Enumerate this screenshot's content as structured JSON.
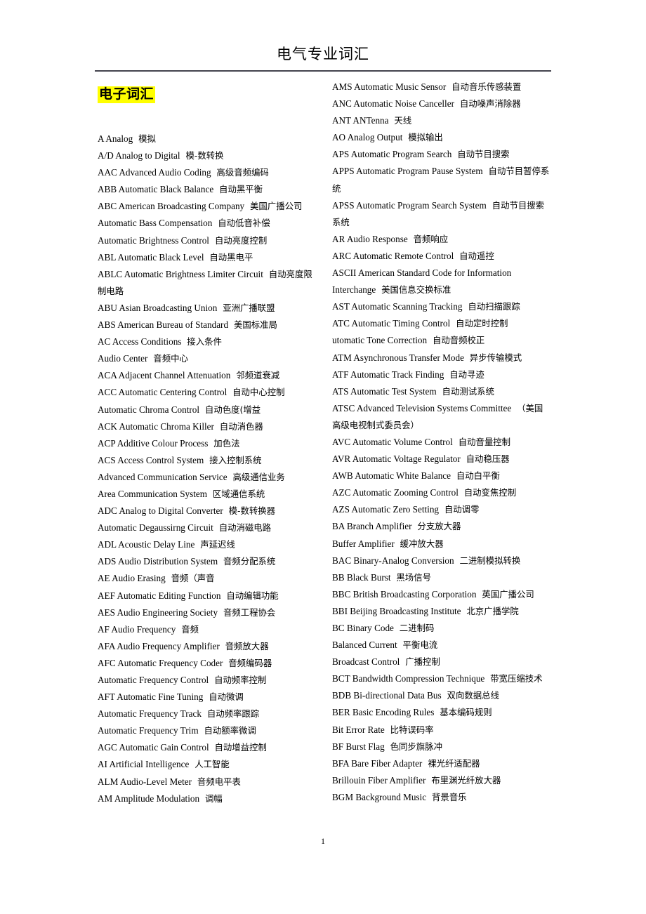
{
  "document": {
    "title": "电气专业词汇",
    "page_number": "1",
    "section_heading": "电子词汇",
    "highlight_color": "#ffff00",
    "rule_color": "#43434d"
  },
  "columns": {
    "left": [
      {
        "term": "A Analog",
        "cn": "模拟"
      },
      {
        "term": "A/D Analog to Digital",
        "cn": "模-数转换"
      },
      {
        "term": "AAC Advanced Audio Coding",
        "cn": "高级音频编码"
      },
      {
        "term": "ABB Automatic Black Balance",
        "cn": "自动黑平衡"
      },
      {
        "term": "ABC American Broadcasting Company",
        "cn": "美国广播公司"
      },
      {
        "term": "Automatic Bass Compensation",
        "cn": "自动低音补偿"
      },
      {
        "term": "Automatic Brightness Control",
        "cn": "自动亮度控制"
      },
      {
        "term": "ABL Automatic Black Level",
        "cn": "自动黑电平"
      },
      {
        "term": "ABLC Automatic Brightness Limiter Circuit",
        "cn": "自动亮度限制电路"
      },
      {
        "term": "ABU Asian Broadcasting Union",
        "cn": "亚洲广播联盟"
      },
      {
        "term": "ABS American Bureau of Standard",
        "cn": "美国标准局"
      },
      {
        "term": "AC Access Conditions",
        "cn": "接入条件"
      },
      {
        "term": "Audio Center",
        "cn": "音频中心"
      },
      {
        "term": "ACA Adjacent Channel Attenuation",
        "cn": "邻频道衰减"
      },
      {
        "term": "ACC Automatic Centering Control",
        "cn": "自动中心控制"
      },
      {
        "term": "Automatic Chroma Control",
        "cn": "自动色度(增益"
      },
      {
        "term": "ACK Automatic Chroma Killer",
        "cn": "自动消色器"
      },
      {
        "term": "ACP Additive Colour Process",
        "cn": "加色法"
      },
      {
        "term": "ACS Access Control System",
        "cn": "接入控制系统"
      },
      {
        "term": "Advanced Communication Service",
        "cn": "高级通信业务"
      },
      {
        "term": "Area Communication System",
        "cn": "区域通信系统"
      },
      {
        "term": "ADC Analog to Digital Converter",
        "cn": "模-数转换器"
      },
      {
        "term": "Automatic Degaussirng Circuit",
        "cn": "自动消磁电路"
      },
      {
        "term": "ADL Acoustic Delay Line",
        "cn": "声延迟线"
      },
      {
        "term": "ADS Audio Distribution System",
        "cn": "音频分配系统"
      },
      {
        "term": "AE Audio Erasing",
        "cn": "音频（声音"
      },
      {
        "term": "AEF Automatic Editing Function",
        "cn": "自动编辑功能"
      },
      {
        "term": "AES Audio Engineering Society",
        "cn": "音频工程协会"
      },
      {
        "term": "AF Audio Frequency",
        "cn": "音频"
      },
      {
        "term": "AFA Audio Frequency Amplifier",
        "cn": "音频放大器"
      },
      {
        "term": "AFC Automatic Frequency Coder",
        "cn": "音频编码器"
      },
      {
        "term": "Automatic Frequency Control",
        "cn": "自动频率控制"
      },
      {
        "term": "AFT Automatic Fine Tuning",
        "cn": "自动微调"
      },
      {
        "term": "Automatic Frequency Track",
        "cn": "自动频率跟踪"
      },
      {
        "term": "Automatic Frequency Trim",
        "cn": "自动额率微调"
      },
      {
        "term": "AGC Automatic Gain Control",
        "cn": "自动增益控制"
      },
      {
        "term": "AI Artificial Intelligence",
        "cn": "人工智能"
      },
      {
        "term": "ALM Audio-Level Meter",
        "cn": "音频电平表"
      },
      {
        "term": "AM Amplitude Modulation",
        "cn": "调幅"
      }
    ],
    "right": [
      {
        "term": "AMS Automatic Music Sensor",
        "cn": "自动音乐传感装置"
      },
      {
        "term": "ANC Automatic Noise Canceller",
        "cn": "自动噪声消除器"
      },
      {
        "term": "ANT ANTenna",
        "cn": "天线"
      },
      {
        "term": "AO Analog Output",
        "cn": "模拟输出"
      },
      {
        "term": "APS Automatic Program Search",
        "cn": "自动节目搜索"
      },
      {
        "term": "APPS Automatic Program Pause System",
        "cn": "自动节目暂停系统"
      },
      {
        "term": "APSS Automatic Program Search System",
        "cn": "自动节目搜索系统"
      },
      {
        "term": "AR Audio Response",
        "cn": "音频响应"
      },
      {
        "term": "ARC Automatic Remote Control",
        "cn": "自动遥控"
      },
      {
        "term": "ASCII American Standard Code for Information Interchange",
        "cn": "美国信息交换标准"
      },
      {
        "term": "AST Automatic Scanning Tracking",
        "cn": "自动扫描跟踪"
      },
      {
        "term": "ATC Automatic Timing Control",
        "cn": "自动定时控制"
      },
      {
        "term": "utomatic Tone Correction",
        "cn": "自动音频校正"
      },
      {
        "term": "ATM Asynchronous Transfer Mode",
        "cn": "异步传输模式"
      },
      {
        "term": "ATF Automatic Track Finding",
        "cn": "自动寻迹"
      },
      {
        "term": "ATS Automatic Test System",
        "cn": "自动测试系统"
      },
      {
        "term": "ATSC Advanced Television Systems Committee",
        "cn": "（美国高级电视制式委员会）"
      },
      {
        "term": "AVC Automatic Volume Control",
        "cn": "自动音量控制"
      },
      {
        "term": "AVR Automatic Voltage Regulator",
        "cn": "自动稳压器"
      },
      {
        "term": "AWB Automatic White Balance",
        "cn": "自动白平衡"
      },
      {
        "term": "AZC Automatic Zooming Control",
        "cn": "自动变焦控制"
      },
      {
        "term": "AZS  Automatic Zero Setting",
        "cn": "自动调零"
      },
      {
        "term": "BA Branch Amplifier",
        "cn": "分支放大器"
      },
      {
        "term": "Buffer Amplifier",
        "cn": "缓冲放大器"
      },
      {
        "term": "BAC Binary-Analog Conversion",
        "cn": "二进制模拟转换"
      },
      {
        "term": "BB Black Burst",
        "cn": "黑场信号"
      },
      {
        "term": "BBC British Broadcasting Corporation",
        "cn": "英国广播公司"
      },
      {
        "term": "BBI Beijing Broadcasting Institute",
        "cn": "北京广播学院"
      },
      {
        "term": "BC Binary Code",
        "cn": "二进制码"
      },
      {
        "term": "Balanced Current",
        "cn": "平衡电流"
      },
      {
        "term": "Broadcast Control",
        "cn": "广播控制"
      },
      {
        "term": "BCT Bandwidth Compression Technique",
        "cn": "带宽压缩技术"
      },
      {
        "term": "BDB Bi-directional Data Bus",
        "cn": "双向数据总线"
      },
      {
        "term": "BER Basic Encoding Rules",
        "cn": "基本编码规则"
      },
      {
        "term": "Bit Error Rate",
        "cn": "比特误码率"
      },
      {
        "term": "BF Burst Flag",
        "cn": "色同步旗脉冲"
      },
      {
        "term": "BFA Bare Fiber Adapter",
        "cn": "裸光纤适配器"
      },
      {
        "term": "Brillouin Fiber Amplifier",
        "cn": "布里渊光纤放大器"
      },
      {
        "term": "BGM Background Music",
        "cn": "背景音乐"
      }
    ]
  }
}
